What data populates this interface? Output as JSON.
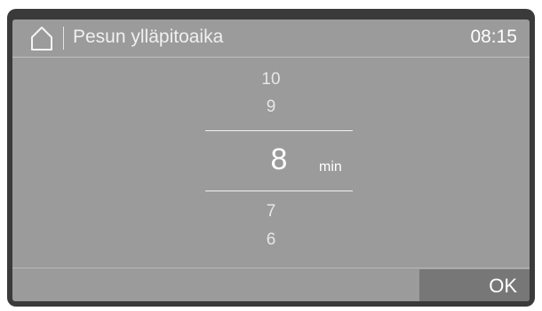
{
  "header": {
    "home_icon": "home-icon",
    "title": "Pesun ylläpitoaika",
    "time": "08:15"
  },
  "picker": {
    "values_above": [
      "10",
      "9"
    ],
    "selected": "8",
    "unit": "min",
    "values_below": [
      "7",
      "6"
    ]
  },
  "footer": {
    "ok_label": "OK"
  },
  "colors": {
    "screen_background": "#9b9b9b",
    "bezel": "#3a3a3a",
    "ok_button": "#777777"
  }
}
